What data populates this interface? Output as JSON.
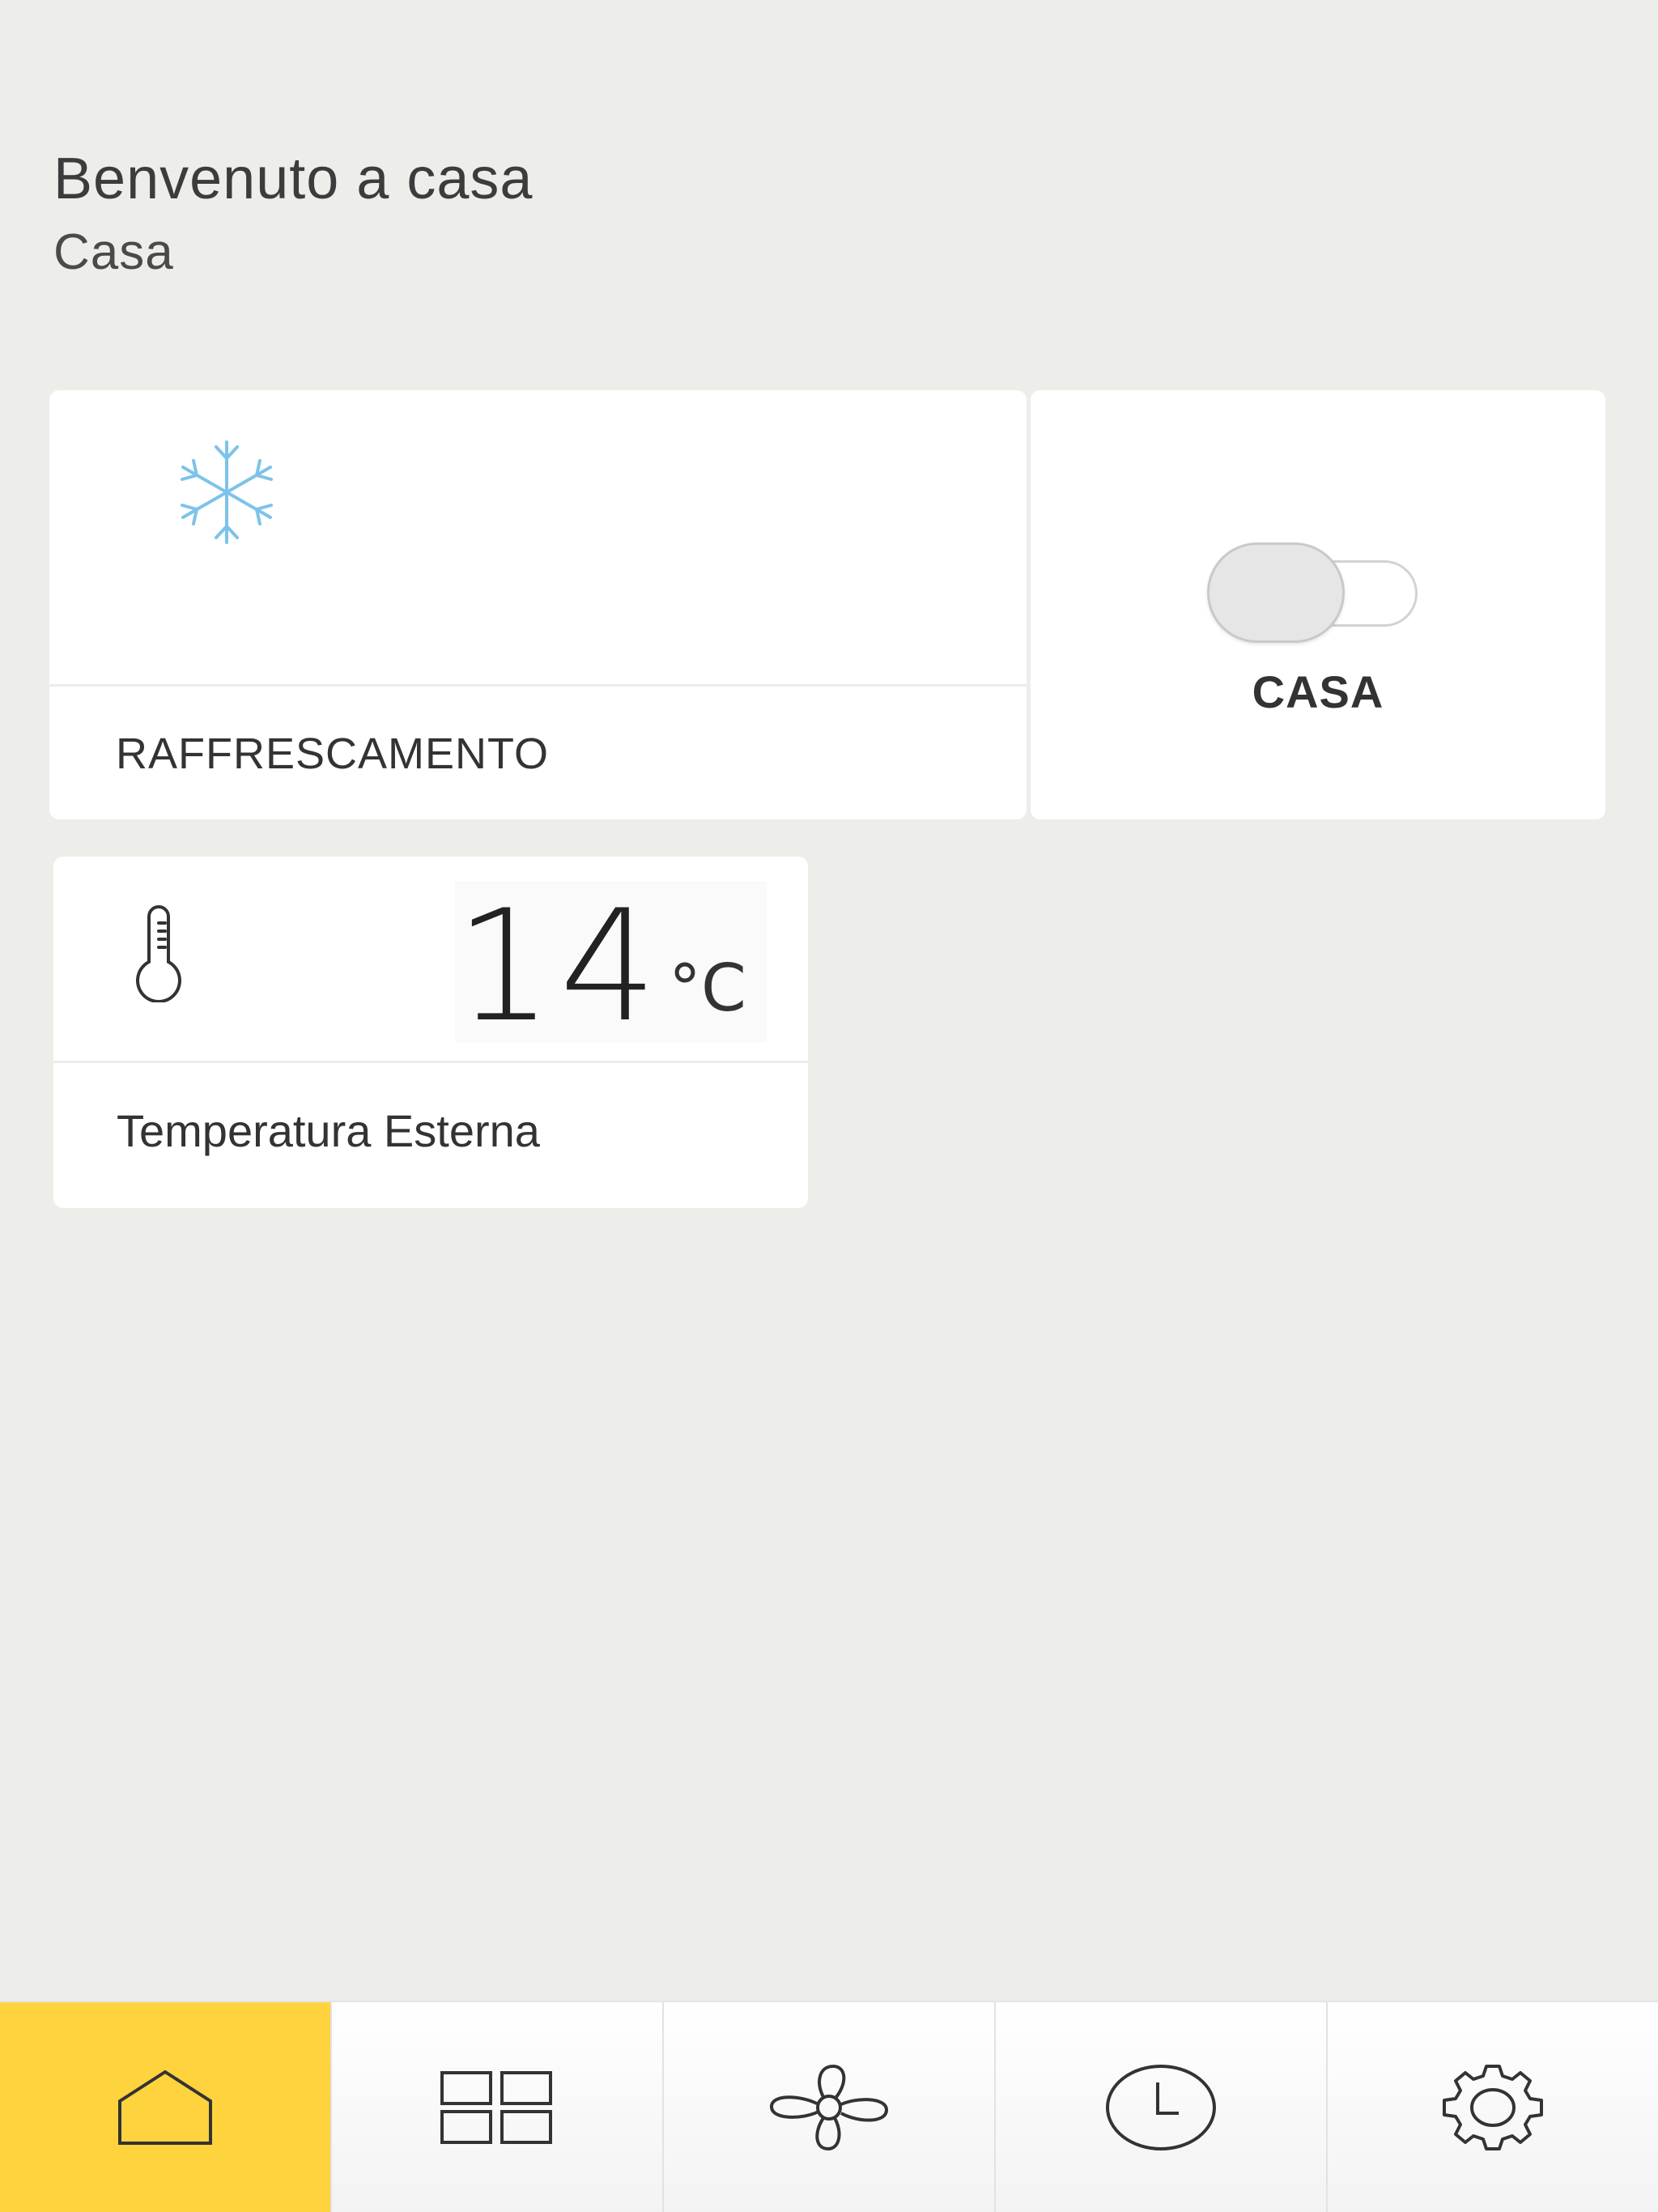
{
  "header": {
    "title": "Benvenuto a casa",
    "location": "Casa"
  },
  "mode_card": {
    "icon": "snowflake-icon",
    "label": "RAFFRESCAMENTO",
    "icon_color": "#7CC3EA"
  },
  "profile_card": {
    "label": "CASA",
    "toggle_on": false
  },
  "temperature_card": {
    "icon": "thermometer-icon",
    "value": "14",
    "unit": "°C",
    "label": "Temperatura Esterna"
  },
  "nav": {
    "active_color": "#FFD33D",
    "items": [
      {
        "icon": "home-icon",
        "active": true
      },
      {
        "icon": "grid-icon",
        "active": false
      },
      {
        "icon": "fan-icon",
        "active": false
      },
      {
        "icon": "clock-icon",
        "active": false
      },
      {
        "icon": "gear-icon",
        "active": false
      }
    ]
  }
}
